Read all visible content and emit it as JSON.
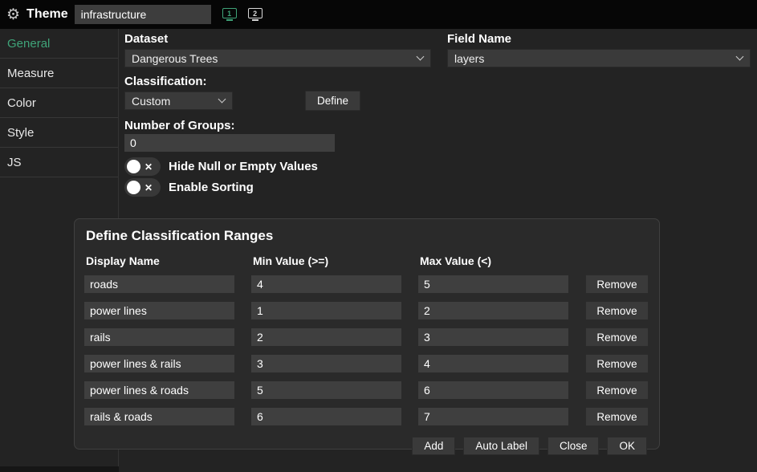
{
  "colors": {
    "accent": "#3fa479"
  },
  "icons": {
    "gear": "⚙",
    "x": "✕"
  },
  "topbar": {
    "title": "Theme",
    "theme_input_value": "infrastructure",
    "screen1_label": "1",
    "screen2_label": "2"
  },
  "sidebar": {
    "items": [
      {
        "label": "General",
        "active": true
      },
      {
        "label": "Measure",
        "active": false
      },
      {
        "label": "Color",
        "active": false
      },
      {
        "label": "Style",
        "active": false
      },
      {
        "label": "JS",
        "active": false
      }
    ]
  },
  "form": {
    "dataset_label": "Dataset",
    "dataset_value": "Dangerous Trees",
    "field_name_label": "Field Name",
    "field_name_value": "layers",
    "classification_label": "Classification:",
    "classification_value": "Custom",
    "define_button": "Define",
    "groups_label": "Number of Groups:",
    "groups_value": "0",
    "hide_null_label": "Hide Null or Empty Values",
    "enable_sorting_label": "Enable Sorting"
  },
  "panel": {
    "title": "Define Classification Ranges",
    "columns": [
      "Display Name",
      "Min Value (>=)",
      "Max Value (<)"
    ],
    "remove_label": "Remove",
    "rows": [
      {
        "name": "roads",
        "min": "4",
        "max": "5"
      },
      {
        "name": "power lines",
        "min": "1",
        "max": "2"
      },
      {
        "name": "rails",
        "min": "2",
        "max": "3"
      },
      {
        "name": "power lines & rails",
        "min": "3",
        "max": "4"
      },
      {
        "name": "power lines & roads",
        "min": "5",
        "max": "6"
      },
      {
        "name": "rails & roads",
        "min": "6",
        "max": "7"
      }
    ],
    "buttons": {
      "add": "Add",
      "auto_label": "Auto Label",
      "close": "Close",
      "ok": "OK"
    }
  }
}
